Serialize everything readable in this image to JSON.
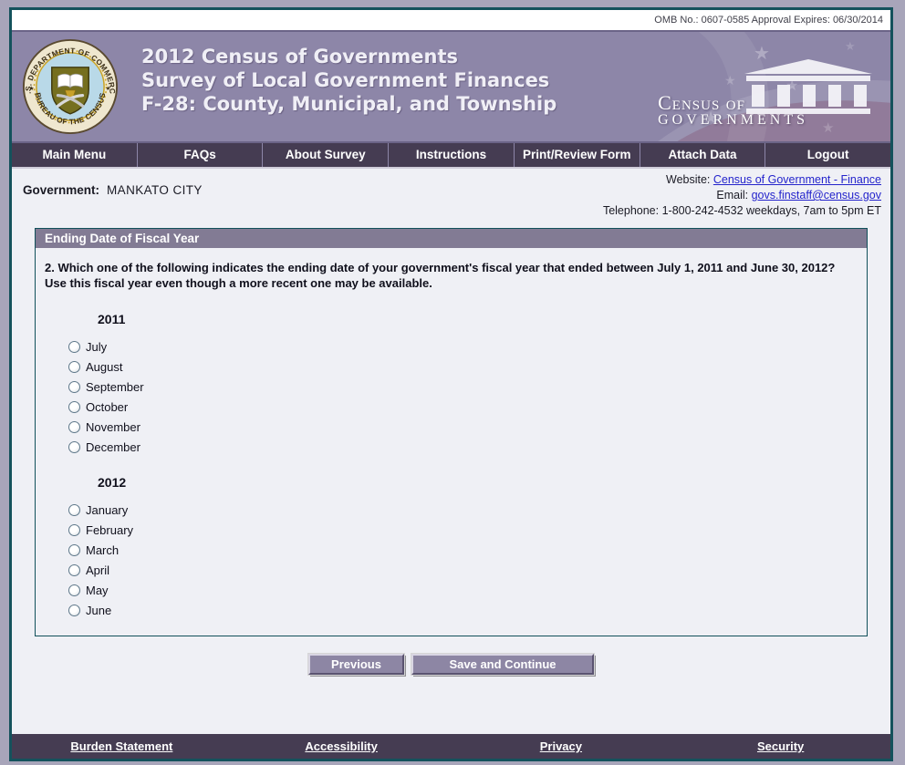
{
  "omb_bar": {
    "text": "OMB No.: 0607-0585 Approval Expires: 06/30/2014"
  },
  "header": {
    "title_line1": "2012 Census of Governments",
    "title_line2": "Survey of Local Government Finances",
    "title_line3": "F-28: County, Municipal, and Township",
    "seal_text_top": "U.S. DEPARTMENT OF COMMERCE",
    "seal_text_bottom": "BUREAU OF THE CENSUS",
    "logo_line1": "Census of",
    "logo_line2": "Governments"
  },
  "nav": {
    "items": [
      "Main Menu",
      "FAQs",
      "About Survey",
      "Instructions",
      "Print/Review Form",
      "Attach Data",
      "Logout"
    ]
  },
  "info": {
    "government_label": "Government:",
    "government_value": "MANKATO CITY",
    "website_label": "Website: ",
    "website_link": "Census of Government - Finance",
    "email_label": "Email: ",
    "email_link": "govs.finstaff@census.gov",
    "telephone_text": "Telephone: 1-800-242-4532 weekdays, 7am to 5pm ET"
  },
  "form": {
    "section_title": "Ending Date of Fiscal Year",
    "question": "2. Which one of the following indicates the ending date of your government's fiscal year that ended between July 1, 2011 and June 30, 2012? Use this fiscal year even though a more recent one may be available.",
    "groups": [
      {
        "year": "2011",
        "months": [
          "July",
          "August",
          "September",
          "October",
          "November",
          "December"
        ]
      },
      {
        "year": "2012",
        "months": [
          "January",
          "February",
          "March",
          "April",
          "May",
          "June"
        ]
      }
    ],
    "selected": null
  },
  "buttons": {
    "previous": "Previous",
    "save_continue": "Save and Continue"
  },
  "footer": {
    "links": [
      "Burden Statement",
      "Accessibility",
      "Privacy",
      "Security"
    ]
  },
  "colors": {
    "header_purple": "#8d86a8",
    "dark_purple": "#453c52",
    "teal_border": "#14525c",
    "section_bar": "#827b94",
    "page_bg": "#eff0f5",
    "link_blue": "#2424cc",
    "outer_bg": "#a8a5ba"
  }
}
